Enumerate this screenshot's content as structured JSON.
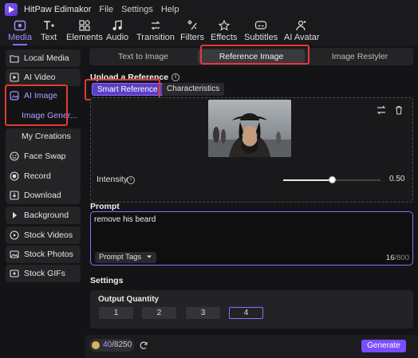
{
  "app": {
    "name": "HitPaw Edimakor",
    "menu": [
      "File",
      "Settings",
      "Help"
    ]
  },
  "toolbar": {
    "items": [
      {
        "label": "Media",
        "icon": "media-icon",
        "active": true
      },
      {
        "label": "Text",
        "icon": "text-icon",
        "active": false
      },
      {
        "label": "Elements",
        "icon": "elements-icon",
        "active": false
      },
      {
        "label": "Audio",
        "icon": "audio-icon",
        "active": false
      },
      {
        "label": "Transition",
        "icon": "transition-icon",
        "active": false
      },
      {
        "label": "Filters",
        "icon": "filters-icon",
        "active": false
      },
      {
        "label": "Effects",
        "icon": "effects-icon",
        "active": false
      },
      {
        "label": "Subtitles",
        "icon": "subtitles-icon",
        "active": false
      },
      {
        "label": "AI Avatar",
        "icon": "ai-avatar-icon",
        "active": false
      }
    ]
  },
  "sidebar": {
    "items": [
      {
        "label": "Local Media",
        "icon": "folder-icon"
      },
      {
        "label": "AI Video",
        "icon": "ai-video-icon"
      },
      {
        "label": "AI Image",
        "icon": "ai-image-icon"
      },
      {
        "label": "Image Gener...",
        "icon": ""
      },
      {
        "label": "My Creations",
        "icon": ""
      },
      {
        "label": "Face Swap",
        "icon": "face-swap-icon"
      },
      {
        "label": "Record",
        "icon": "record-icon"
      },
      {
        "label": "Download",
        "icon": "download-icon"
      },
      {
        "label": "Background",
        "icon": "background-icon"
      },
      {
        "label": "Stock Videos",
        "icon": "stock-videos-icon"
      },
      {
        "label": "Stock Photos",
        "icon": "stock-photos-icon"
      },
      {
        "label": "Stock GIFs",
        "icon": "stock-gifs-icon"
      }
    ]
  },
  "main": {
    "tabs": [
      {
        "label": "Text to Image",
        "active": false
      },
      {
        "label": "Reference Image",
        "active": true
      },
      {
        "label": "Image Restyler",
        "active": false
      }
    ],
    "upload_label": "Upload a Reference",
    "info_glyph": "i",
    "ref_modes": [
      {
        "label": "Smart Reference",
        "active": true
      },
      {
        "label": "Characteristics",
        "active": false
      }
    ],
    "intensity_label": "Intensity",
    "intensity_value": "0.50",
    "intensity_fraction": 0.5,
    "prompt_label": "Prompt",
    "prompt_text": "remove his beard",
    "prompt_tags_label": "Prompt Tags",
    "prompt_count": "16",
    "prompt_max": "/800",
    "settings_label": "Settings",
    "output_quantity_label": "Output Quantity",
    "quantity_options": [
      "1",
      "2",
      "3",
      "4"
    ],
    "quantity_selected": "4",
    "credits_current": "40",
    "credits_total": "/8250",
    "generate_label": "Generate"
  },
  "colors": {
    "accent": "#8c6cff",
    "generate": "#7c4dff",
    "highlight_box": "#e53935",
    "panel": "#242427",
    "background": "#141416"
  }
}
